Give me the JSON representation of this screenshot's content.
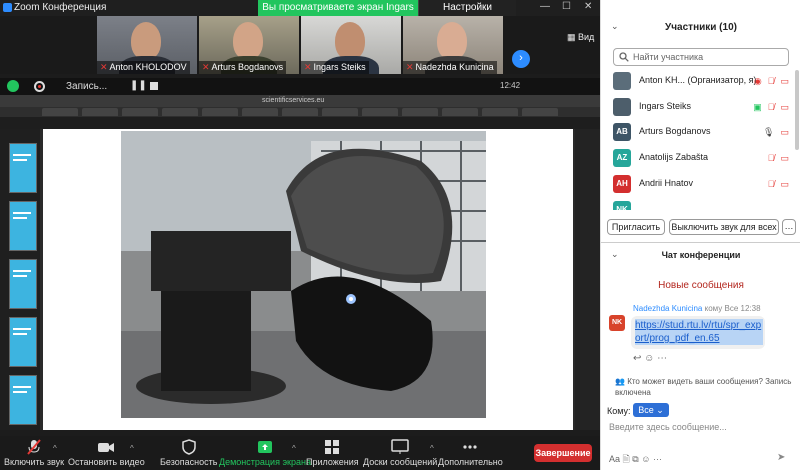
{
  "window": {
    "title": "Zoom Конференция"
  },
  "banner": {
    "sharing": "Вы просматриваете экран Ingars Steiks",
    "settings": "Настройки просмотра",
    "view": "Вид"
  },
  "participants_strip": [
    {
      "name": "Anton KHOLODOV"
    },
    {
      "name": "Arturs Bogdanovs"
    },
    {
      "name": "Ingars Steiks"
    },
    {
      "name": "Nadezhda Kunicina"
    }
  ],
  "recording": {
    "label": "Запись..."
  },
  "browser": {
    "url": "scientificservices.eu",
    "clock": "12:42"
  },
  "toolbar": {
    "unmute": "Включить звук",
    "stop_video": "Остановить видео",
    "security": "Безопасность",
    "share_screen": "Демонстрация экрана",
    "apps": "Приложения",
    "whiteboards": "Доски сообщений",
    "more": "Дополнительно",
    "end": "Завершение"
  },
  "panel": {
    "participants_title": "Участники (10)",
    "search_placeholder": "Найти участника",
    "participants": [
      {
        "name": "Anton KH... (Организатор, я)",
        "initials": "",
        "color": "#5b6d7a"
      },
      {
        "name": "Ingars Steiks",
        "initials": "",
        "color": "#4d5e6b"
      },
      {
        "name": "Arturs Bogdanovs",
        "initials": "AB",
        "color": "#3e5566"
      },
      {
        "name": "Anatolijs Zabašta",
        "initials": "AZ",
        "color": "#26a69a"
      },
      {
        "name": "Andrii Hnatov",
        "initials": "AH",
        "color": "#d32f2f"
      },
      {
        "name": "",
        "initials": "NK",
        "color": "#26a69a"
      }
    ],
    "invite": "Пригласить",
    "mute_all": "Выключить звук для всех",
    "chat_title": "Чат конференции",
    "new_messages": "Новые сообщения",
    "message": {
      "sender": "Nadezhda Kunicina",
      "recipient": "кому Все",
      "time": "12:38",
      "avatar": "NK",
      "text": "https://stud.rtu.lv/rtu/spr_export/prog_pdf_en.65"
    },
    "who_sees": "Кто может видеть ваши сообщения? Запись включена",
    "to_label": "Кому:",
    "to_value": "Все",
    "input_placeholder": "Введите здесь сообщение..."
  }
}
